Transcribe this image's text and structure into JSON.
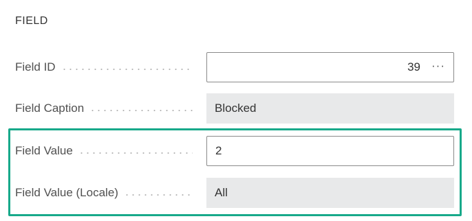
{
  "section": {
    "title": "FIELD"
  },
  "fields": [
    {
      "label": "Field ID",
      "value": "39",
      "assist_icon": "ellipsis-icon",
      "assist_glyph": "···"
    },
    {
      "label": "Field Caption",
      "value": "Blocked"
    },
    {
      "label": "Field Value",
      "value": "2"
    },
    {
      "label": "Field Value (Locale)",
      "value": "All"
    }
  ],
  "colors": {
    "highlight_border": "#17a98a",
    "readonly_background": "#e8e9ea",
    "input_border": "#8a8a8a"
  }
}
